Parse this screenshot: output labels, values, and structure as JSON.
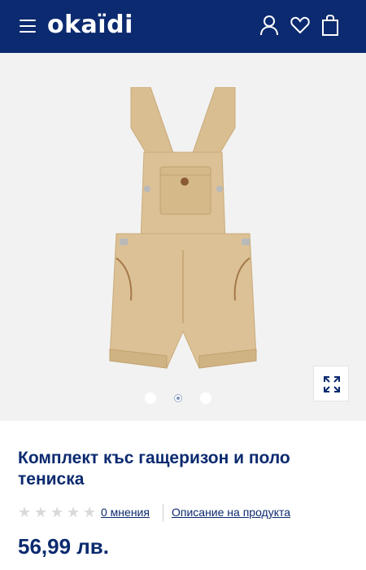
{
  "header": {
    "logo": "okaïdi",
    "menu_icon": "hamburger-menu-icon",
    "account_icon": "user-icon",
    "wishlist_icon": "heart-icon",
    "cart_icon": "shopping-bag-icon",
    "background_color": "#0b2a6f"
  },
  "gallery": {
    "image_alt": "product-overalls-image",
    "zoom_icon": "expand-icon",
    "dots_count": 3,
    "active_dot": 2
  },
  "product": {
    "title": "Комплект къс гащеризон и поло тениска",
    "reviews_link": "0 мнения",
    "rating": 0,
    "rating_max": 5,
    "description_link": "Описание на продукта",
    "price": "56,99 лв."
  },
  "colors": {
    "brand": "#0b2a6f",
    "star_empty": "#d9d9d9",
    "gallery_bg": "#f2f2f2",
    "product_beige": "#d8bb8c"
  }
}
